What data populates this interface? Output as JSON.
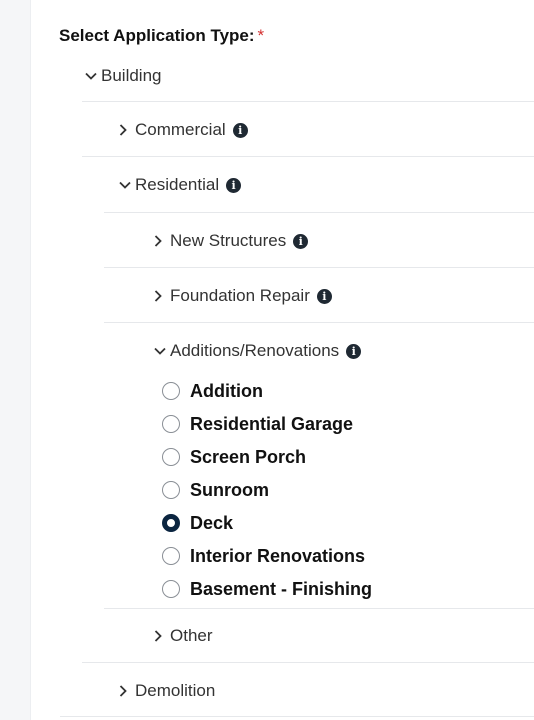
{
  "form": {
    "label": "Select Application Type:",
    "required_mark": "*"
  },
  "tree": {
    "building": {
      "label": "Building",
      "expanded": true
    },
    "commercial": {
      "label": "Commercial",
      "expanded": false,
      "icon": "info-icon"
    },
    "residential": {
      "label": "Residential",
      "expanded": true,
      "icon": "info-icon"
    },
    "new_structures": {
      "label": "New Structures",
      "expanded": false,
      "icon": "info-icon"
    },
    "foundation_repair": {
      "label": "Foundation Repair",
      "expanded": false,
      "icon": "info-icon"
    },
    "additions": {
      "label": "Additions/Renovations",
      "expanded": true,
      "icon": "info-icon"
    },
    "other": {
      "label": "Other",
      "expanded": false
    },
    "demolition": {
      "label": "Demolition",
      "expanded": false
    }
  },
  "options": [
    {
      "label": "Addition",
      "selected": false
    },
    {
      "label": "Residential Garage",
      "selected": false
    },
    {
      "label": "Screen Porch",
      "selected": false
    },
    {
      "label": "Sunroom",
      "selected": false
    },
    {
      "label": "Deck",
      "selected": true
    },
    {
      "label": "Interior Renovations",
      "selected": false
    },
    {
      "label": "Basement - Finishing",
      "selected": false
    }
  ],
  "colors": {
    "accent": "#0b2540",
    "required": "#d32f2f",
    "divider": "#e6e8eb"
  }
}
